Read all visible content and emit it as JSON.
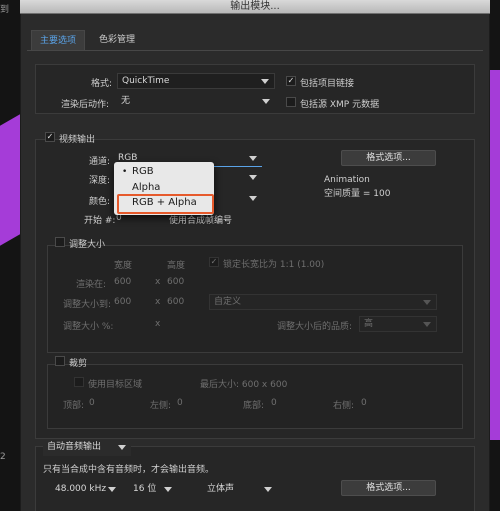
{
  "window": {
    "title": "输出模块..."
  },
  "background": {
    "left_text_top": "到",
    "left_text_bottom": "2"
  },
  "tabs": [
    {
      "label": "主要选项"
    },
    {
      "label": "色彩管理"
    }
  ],
  "main": {
    "format_label": "格式:",
    "format_value": "QuickTime",
    "include_project_link_label": "包括项目链接",
    "post_render_label": "渲染后动作:",
    "post_render_value": "无",
    "include_xmp_label": "包括源 XMP 元数据"
  },
  "video": {
    "section_label": "视频输出",
    "channels_label": "通道:",
    "channels_value": "RGB",
    "depth_label": "深度:",
    "color_label": "颜色:",
    "start_label": "开始 #:",
    "start_value": "0",
    "use_comp_frame_label": "使用合成帧编号",
    "format_options_button": "格式选项...",
    "codec_name": "Animation",
    "spatial_quality": "空间质量 = 100"
  },
  "popup_menu": {
    "items": [
      "RGB",
      "Alpha",
      "RGB + Alpha"
    ],
    "checked_mark": "•",
    "highlight_color": "#e65a2c"
  },
  "resize": {
    "section_label": "调整大小",
    "width_header": "宽度",
    "height_header": "高度",
    "lock_aspect_label": "锁定长宽比为 1:1 (1.00)",
    "render_at_label": "渲染在:",
    "render_at_w": "600",
    "render_at_h": "600",
    "times": "x",
    "resize_to_label": "调整大小到:",
    "resize_to_w": "600",
    "resize_to_h": "600",
    "preset_value": "自定义",
    "resize_percent_label": "调整大小 %:",
    "quality_label": "调整大小后的品质:",
    "quality_value": "高"
  },
  "crop": {
    "section_label": "裁剪",
    "use_roi_label": "使用目标区域",
    "final_size": "最后大小: 600 x 600",
    "top_label": "顶部:",
    "top_value": "0",
    "left_label": "左侧:",
    "left_value": "0",
    "bottom_label": "底部:",
    "bottom_value": "0",
    "right_label": "右侧:",
    "right_value": "0"
  },
  "audio": {
    "mode_value": "自动音频输出",
    "note": "只有当合成中含有音频时，才会输出音频。",
    "sample_rate": "48.000 kHz",
    "bit_depth": "16 位",
    "channels": "立体声",
    "format_options_button": "格式选项..."
  },
  "icons": {
    "check": "✓",
    "dropdown_arrow": "chevron-down-icon"
  },
  "colors": {
    "accent_tab": "#5aa3e8",
    "background_purple": "#a53cd8"
  }
}
